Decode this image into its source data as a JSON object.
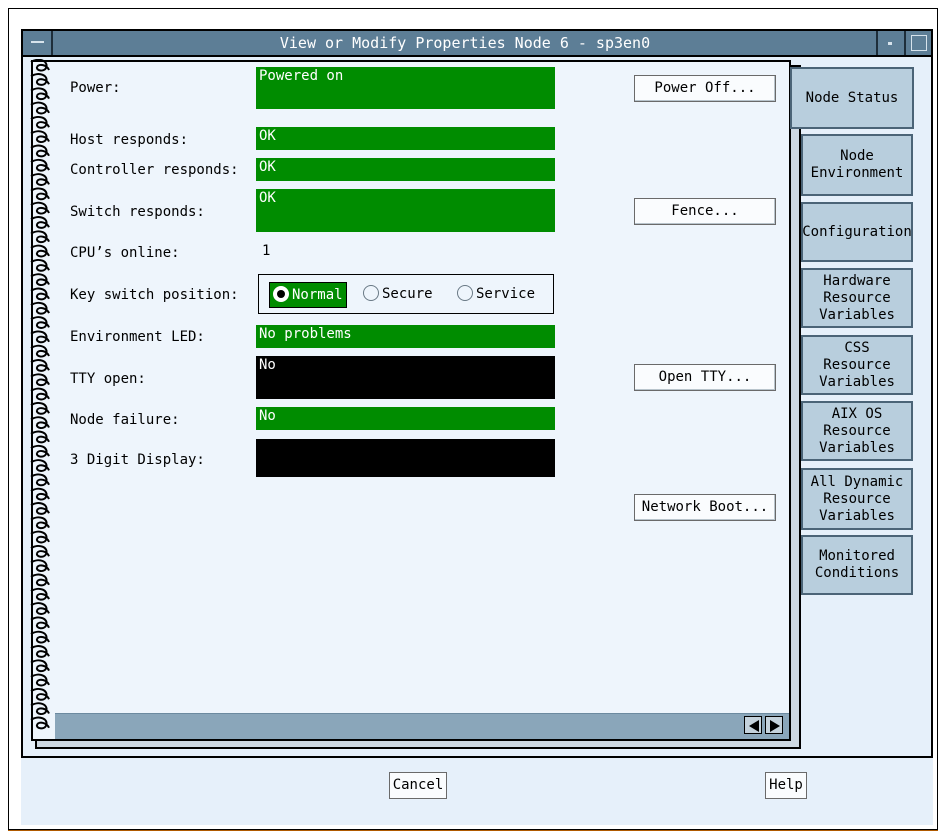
{
  "window": {
    "title": "View or Modify Properties Node 6 - sp3en0"
  },
  "fields": {
    "power": {
      "label": "Power:",
      "value": "Powered on"
    },
    "host": {
      "label": "Host responds:",
      "value": "OK"
    },
    "controller": {
      "label": "Controller responds:",
      "value": "OK"
    },
    "switch": {
      "label": "Switch responds:",
      "value": "OK"
    },
    "cpus": {
      "label": "CPU’s online:",
      "value": "1"
    },
    "keyswitch": {
      "label": "Key switch position:",
      "options": [
        "Normal",
        "Secure",
        "Service"
      ],
      "selected": "Normal"
    },
    "env_led": {
      "label": "Environment LED:",
      "value": "No problems"
    },
    "tty": {
      "label": "TTY open:",
      "value": "No"
    },
    "node_failure": {
      "label": "Node failure:",
      "value": "No"
    },
    "digit_display": {
      "label": "3 Digit Display:",
      "value": ""
    }
  },
  "actions": {
    "power_off": "Power Off...",
    "fence": "Fence...",
    "open_tty": "Open TTY...",
    "network_boot": "Network Boot..."
  },
  "tabs": [
    {
      "label": "Node Status",
      "active": true
    },
    {
      "label": "Node\nEnvironment",
      "active": false
    },
    {
      "label": "Configuration",
      "active": false
    },
    {
      "label": "Hardware\nResource\nVariables",
      "active": false
    },
    {
      "label": "CSS\nResource\nVariables",
      "active": false
    },
    {
      "label": "AIX OS\nResource\nVariables",
      "active": false
    },
    {
      "label": "All Dynamic\nResource\nVariables",
      "active": false
    },
    {
      "label": "Monitored\nConditions",
      "active": false
    }
  ],
  "dialog": {
    "cancel": "Cancel",
    "help": "Help"
  },
  "colors": {
    "status_green": "#008c00",
    "status_black": "#000000",
    "titlebar": "#5d7e96",
    "tab": "#b8cedd"
  },
  "icons": [
    "window-menu-icon",
    "minimize-icon",
    "maximize-icon",
    "scroll-left-icon",
    "scroll-right-icon",
    "spiral-binding-icon"
  ]
}
